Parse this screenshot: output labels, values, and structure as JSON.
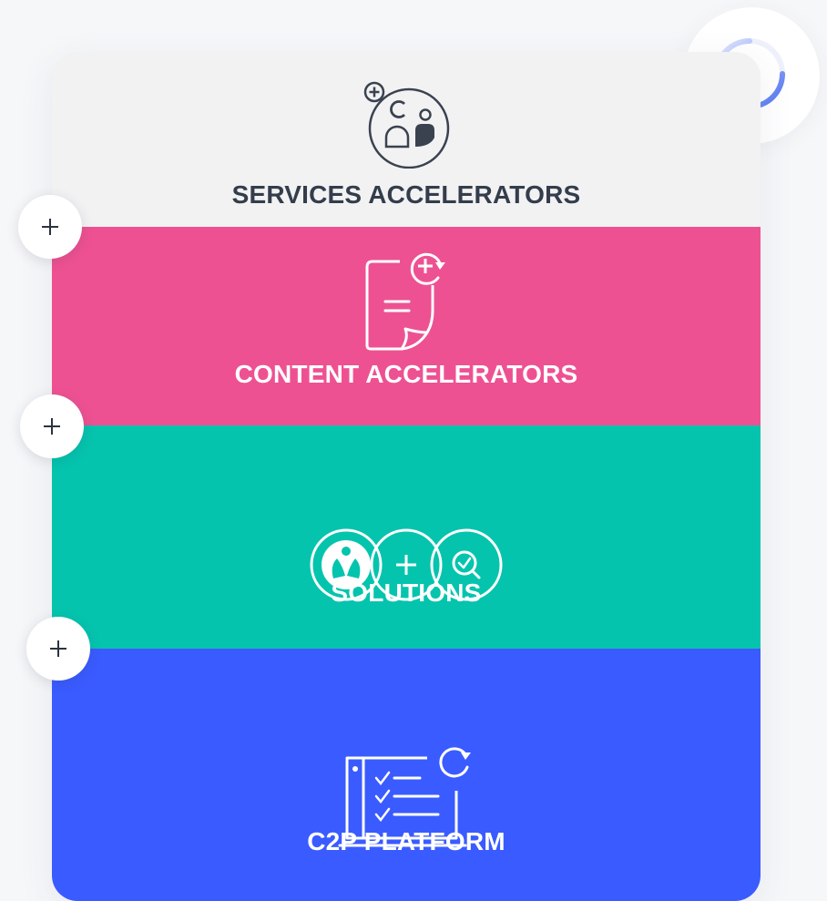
{
  "loading": {
    "icon": "spinner-icon"
  },
  "sections": [
    {
      "label": "SERVICES ACCELERATORS",
      "icon": "services-people-icon",
      "color": "#f2f2f3"
    },
    {
      "label": "CONTENT ACCELERATORS",
      "icon": "document-add-icon",
      "color": "#ee5192"
    },
    {
      "label": "SOLUTIONS",
      "icon": "solutions-circles-icon",
      "color": "#05c4ae"
    },
    {
      "label": "C2P PLATFORM",
      "icon": "platform-checklist-icon",
      "color": "#3a5bff"
    }
  ],
  "expand_buttons": [
    {
      "icon": "plus-icon"
    },
    {
      "icon": "plus-icon"
    },
    {
      "icon": "plus-icon"
    }
  ]
}
